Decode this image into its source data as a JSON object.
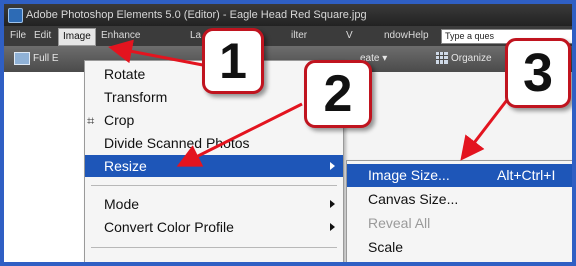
{
  "window": {
    "title": "Adobe Photoshop Elements 5.0 (Editor) - Eagle Head Red Square.jpg"
  },
  "menubar": {
    "items": [
      {
        "label": "File",
        "active": false
      },
      {
        "label": "Edit",
        "active": false
      },
      {
        "label": "Image",
        "active": true
      },
      {
        "label": "Enhance",
        "active": false
      },
      {
        "label": "La",
        "active": false
      },
      {
        "label": "ilter",
        "active": false
      },
      {
        "label": "V",
        "active": false
      },
      {
        "label": "ndow",
        "active": false
      },
      {
        "label": "Help",
        "active": false
      }
    ],
    "search_placeholder": "Type a ques"
  },
  "toolbar": {
    "full_edit_label": "Full E",
    "create_label": "eate ▾",
    "organizer_label": "Organize"
  },
  "image_menu": {
    "items": [
      {
        "label": "Rotate",
        "submenu": false,
        "icon": null
      },
      {
        "label": "Transform",
        "submenu": false,
        "icon": null
      },
      {
        "label": "Crop",
        "submenu": false,
        "icon": "crop-icon"
      },
      {
        "label": "Divide Scanned Photos",
        "submenu": false,
        "icon": null
      },
      {
        "label": "Resize",
        "submenu": true,
        "highlighted": true
      },
      {
        "label": "Mode",
        "submenu": true
      },
      {
        "label": "Convert Color Profile",
        "submenu": true
      }
    ]
  },
  "resize_submenu": {
    "items": [
      {
        "label": "Image Size...",
        "shortcut": "Alt+Ctrl+I",
        "highlighted": true,
        "disabled": false
      },
      {
        "label": "Canvas Size...",
        "shortcut": "",
        "highlighted": false,
        "disabled": false
      },
      {
        "label": "Reveal All",
        "shortcut": "",
        "highlighted": false,
        "disabled": true
      },
      {
        "label": "Scale",
        "shortcut": "",
        "highlighted": false,
        "disabled": false
      }
    ]
  },
  "callouts": [
    "1",
    "2",
    "3"
  ],
  "colors": {
    "frame_border": "#2f5fc4",
    "highlight": "#1e56b8",
    "callout_border": "#c0141f",
    "arrow": "#e3141f"
  }
}
